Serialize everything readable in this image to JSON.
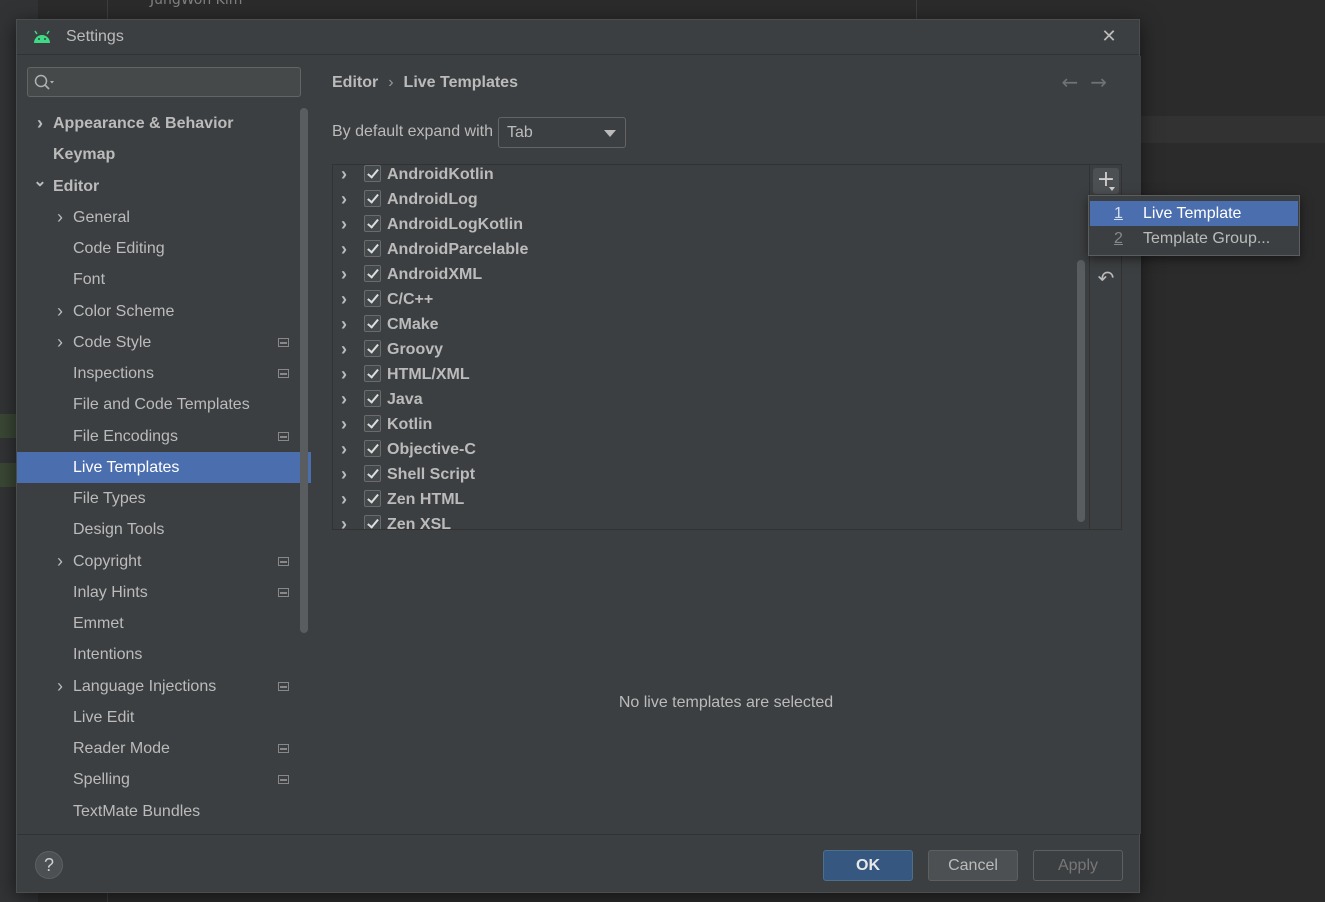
{
  "background": {
    "user_name": "JungWon Kim"
  },
  "dialog": {
    "title": "Settings",
    "icon": "android-icon",
    "close_icon": "close-icon"
  },
  "search": {
    "placeholder": ""
  },
  "sidebar": {
    "items": [
      {
        "label": "Appearance & Behavior",
        "level": 0,
        "expandable": true,
        "expanded": false,
        "bold": true,
        "marker": false
      },
      {
        "label": "Keymap",
        "level": 0,
        "expandable": false,
        "bold": true,
        "marker": false
      },
      {
        "label": "Editor",
        "level": 0,
        "expandable": true,
        "expanded": true,
        "bold": true,
        "marker": false
      },
      {
        "label": "General",
        "level": 1,
        "expandable": true,
        "expanded": false,
        "marker": false
      },
      {
        "label": "Code Editing",
        "level": 1,
        "expandable": false,
        "marker": false
      },
      {
        "label": "Font",
        "level": 1,
        "expandable": false,
        "marker": false
      },
      {
        "label": "Color Scheme",
        "level": 1,
        "expandable": true,
        "expanded": false,
        "marker": false
      },
      {
        "label": "Code Style",
        "level": 1,
        "expandable": true,
        "expanded": false,
        "marker": true
      },
      {
        "label": "Inspections",
        "level": 1,
        "expandable": false,
        "marker": true
      },
      {
        "label": "File and Code Templates",
        "level": 1,
        "expandable": false,
        "marker": false
      },
      {
        "label": "File Encodings",
        "level": 1,
        "expandable": false,
        "marker": true
      },
      {
        "label": "Live Templates",
        "level": 1,
        "expandable": false,
        "marker": false,
        "selected": true
      },
      {
        "label": "File Types",
        "level": 1,
        "expandable": false,
        "marker": false
      },
      {
        "label": "Design Tools",
        "level": 1,
        "expandable": false,
        "marker": false
      },
      {
        "label": "Copyright",
        "level": 1,
        "expandable": true,
        "expanded": false,
        "marker": true
      },
      {
        "label": "Inlay Hints",
        "level": 1,
        "expandable": false,
        "marker": true
      },
      {
        "label": "Emmet",
        "level": 1,
        "expandable": false,
        "marker": false
      },
      {
        "label": "Intentions",
        "level": 1,
        "expandable": false,
        "marker": false
      },
      {
        "label": "Language Injections",
        "level": 1,
        "expandable": true,
        "expanded": false,
        "marker": true
      },
      {
        "label": "Live Edit",
        "level": 1,
        "expandable": false,
        "marker": false
      },
      {
        "label": "Reader Mode",
        "level": 1,
        "expandable": false,
        "marker": true
      },
      {
        "label": "Spelling",
        "level": 1,
        "expandable": false,
        "marker": true
      },
      {
        "label": "TextMate Bundles",
        "level": 1,
        "expandable": false,
        "marker": false
      }
    ]
  },
  "main": {
    "breadcrumb": [
      "Editor",
      "Live Templates"
    ],
    "expand_label": "By default expand with",
    "expand_value": "Tab",
    "templates": [
      {
        "name": "AndroidKotlin",
        "checked": true
      },
      {
        "name": "AndroidLog",
        "checked": true
      },
      {
        "name": "AndroidLogKotlin",
        "checked": true
      },
      {
        "name": "AndroidParcelable",
        "checked": true
      },
      {
        "name": "AndroidXML",
        "checked": true
      },
      {
        "name": "C/C++",
        "checked": true
      },
      {
        "name": "CMake",
        "checked": true
      },
      {
        "name": "Groovy",
        "checked": true
      },
      {
        "name": "HTML/XML",
        "checked": true
      },
      {
        "name": "Java",
        "checked": true
      },
      {
        "name": "Kotlin",
        "checked": true
      },
      {
        "name": "Objective-C",
        "checked": true
      },
      {
        "name": "Shell Script",
        "checked": true
      },
      {
        "name": "Zen HTML",
        "checked": true
      },
      {
        "name": "Zen XSL",
        "checked": true
      }
    ],
    "empty_message": "No live templates are selected"
  },
  "popup": {
    "items": [
      {
        "num": "1",
        "label": "Live Template",
        "active": true
      },
      {
        "num": "2",
        "label": "Template Group...",
        "active": false
      }
    ]
  },
  "footer": {
    "help": "?",
    "ok": "OK",
    "cancel": "Cancel",
    "apply": "Apply"
  },
  "colors": {
    "selection": "#4b6eaf",
    "ok_button": "#365880",
    "dialog_bg": "#3c3f41"
  }
}
